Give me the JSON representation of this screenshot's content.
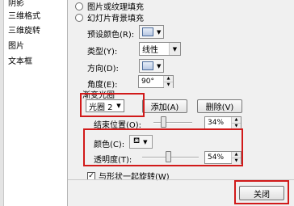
{
  "sidebar": {
    "items": [
      {
        "label": "阴影"
      },
      {
        "label": "三维格式"
      },
      {
        "label": "三维旋转"
      },
      {
        "label": "图片"
      },
      {
        "label": "文本框"
      }
    ]
  },
  "fill_options": {
    "picture_texture": "图片或纹理填充",
    "slide_background": "幻灯片背景填充"
  },
  "preset_color": {
    "label": "预设颜色(R):"
  },
  "type": {
    "label": "类型(Y):",
    "value": "线性"
  },
  "direction": {
    "label": "方向(D):"
  },
  "angle": {
    "label": "角度(E):",
    "value": "90°"
  },
  "gradient_stops": {
    "title": "渐变光圈",
    "stop_value": "光圈 2",
    "add_button": "添加(A)",
    "delete_button": "删除(V)"
  },
  "end_position": {
    "label": "结束位置(O):",
    "value": "34%",
    "level_percent": 34
  },
  "color": {
    "label": "颜色(C):"
  },
  "transparency": {
    "label": "透明度(T):",
    "value": "54%",
    "level_percent": 54
  },
  "rotate_with_shape": {
    "label": "与形状一起旋转(W)",
    "checked": true
  },
  "close_button": "关闭",
  "colors": {
    "highlight": "#d11a1a",
    "dialog_bg": "#f0f0f0"
  }
}
